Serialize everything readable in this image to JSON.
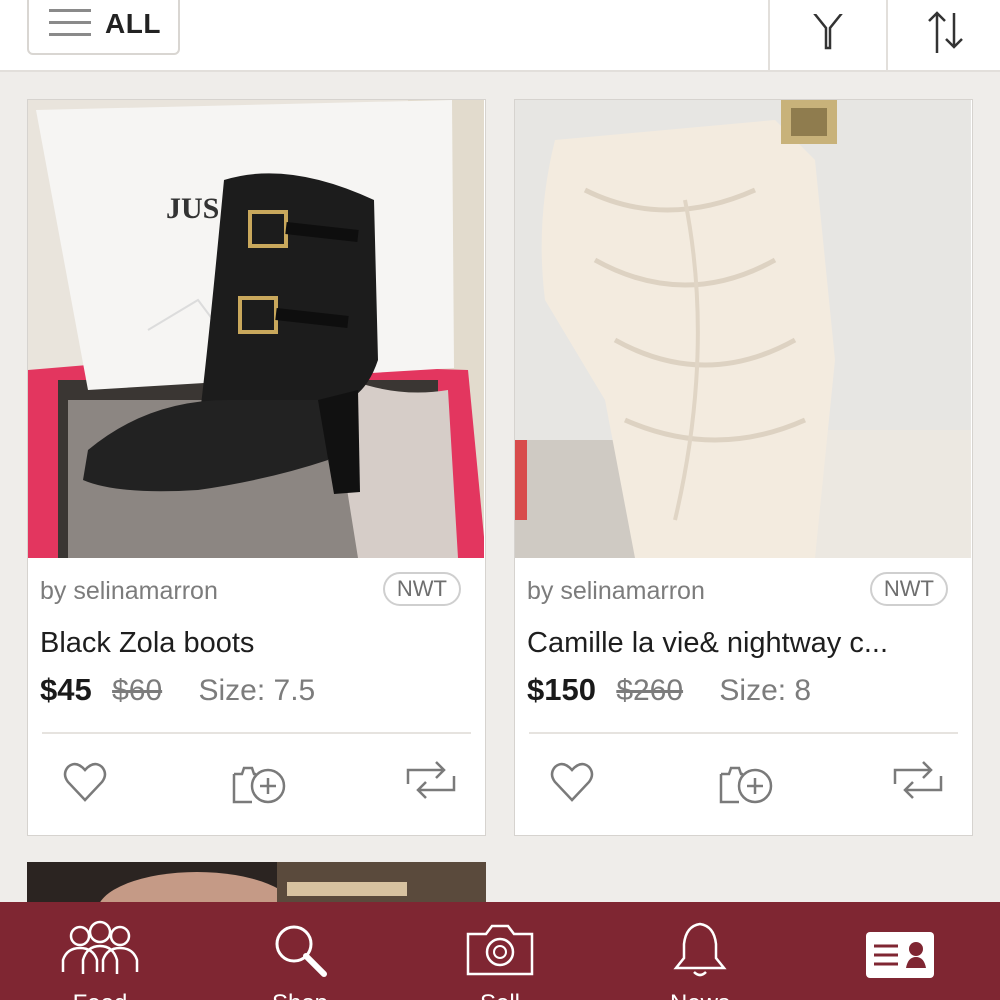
{
  "topbar": {
    "filter_label": "ALL"
  },
  "listings": [
    {
      "seller": "by selinamarron",
      "badge": "NWT",
      "title": "Black Zola boots",
      "price": "$45",
      "original_price": "$60",
      "size": "Size: 7.5"
    },
    {
      "seller": "by selinamarron",
      "badge": "NWT",
      "title": "Camille la vie& nightway c...",
      "price": "$150",
      "original_price": "$260",
      "size": "Size: 8"
    }
  ],
  "bottom_nav": {
    "items": [
      {
        "label": "Feed",
        "icon": "people-icon"
      },
      {
        "label": "Shop",
        "icon": "search-icon"
      },
      {
        "label": "Sell",
        "icon": "camera-icon"
      },
      {
        "label": "News",
        "icon": "bell-icon"
      },
      {
        "label": "",
        "icon": "closet-card-icon"
      }
    ]
  },
  "colors": {
    "nav_bg": "#7f2632",
    "page_bg": "#efedea"
  }
}
